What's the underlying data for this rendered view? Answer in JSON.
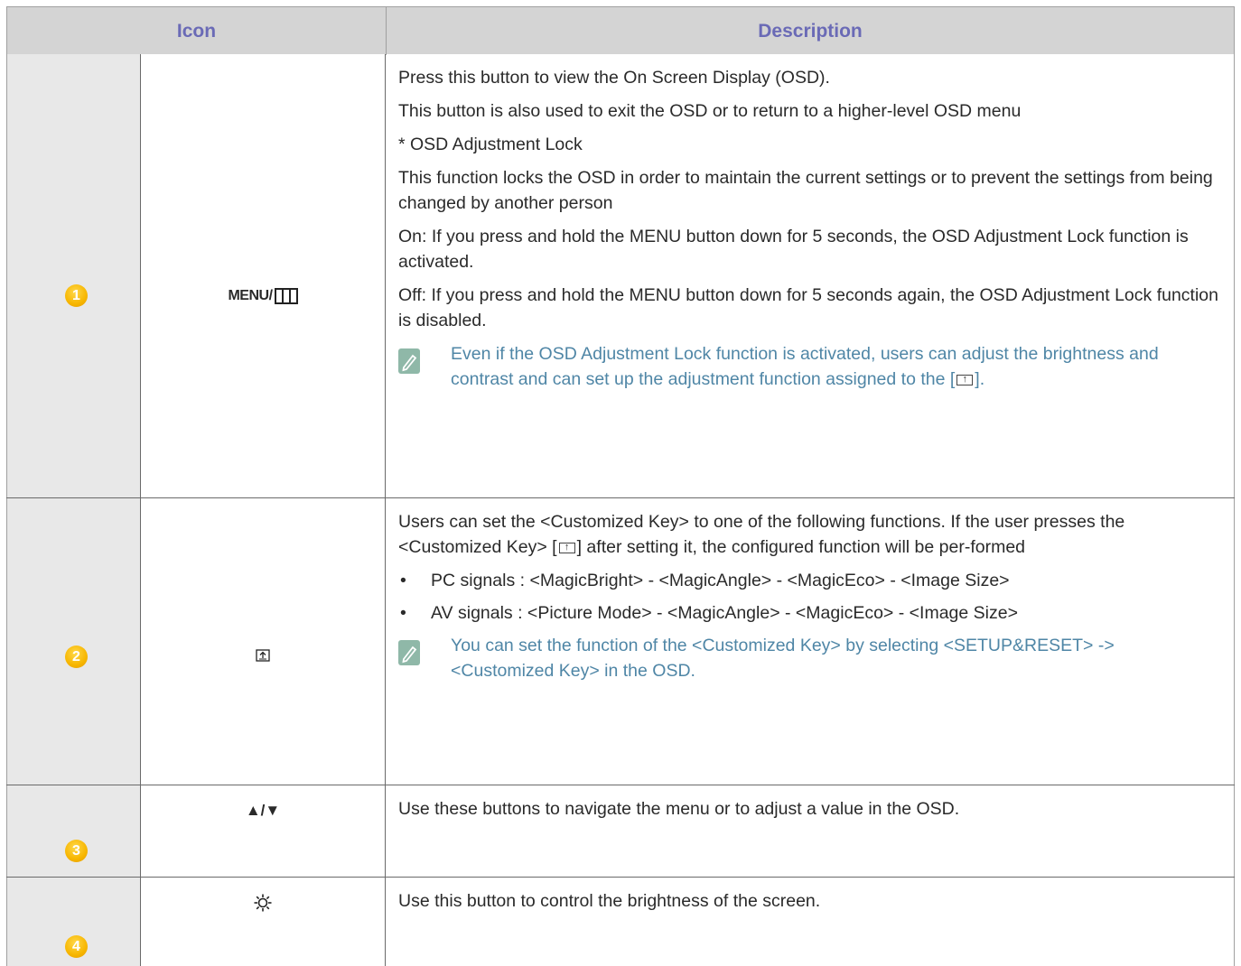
{
  "header": {
    "icon": "Icon",
    "description": "Description"
  },
  "rows": [
    {
      "number": "1",
      "symbol": "MENU/",
      "paragraphs": [
        "Press this button to view the On Screen Display (OSD).",
        "This button is also used to exit the OSD or to return to a higher-level OSD menu",
        "* OSD Adjustment Lock",
        "This function locks the OSD in order to maintain the current settings or to prevent the settings from being changed by another person",
        "On: If you press and hold the MENU button down for 5 seconds, the OSD Adjustment Lock function is activated.",
        "Off: If you press and hold the MENU button down for 5 seconds again, the OSD Adjustment Lock function is disabled."
      ],
      "note_before": "Even if the OSD Adjustment Lock function is activated, users can adjust the brightness and contrast and can set up the adjustment function assigned to the [",
      "note_after": "]."
    },
    {
      "number": "2",
      "intro_before": "Users can set the <Customized Key> to one of the following functions. If the user presses the <Customized Key> [",
      "intro_after": "] after setting it, the configured function will be per-formed",
      "bullets": [
        "PC signals : <MagicBright> - <MagicAngle> - <MagicEco> - <Image Size>",
        "AV signals : <Picture Mode> - <MagicAngle> - <MagicEco> - <Image Size>"
      ],
      "note": "You can set the function of the <Customized Key> by selecting <SETUP&RESET> -> <Customized Key> in the OSD."
    },
    {
      "number": "3",
      "symbol": "▲/▼",
      "text": "Use these buttons to navigate the menu or to adjust a value in the OSD."
    },
    {
      "number": "4",
      "text": "Use this button to control the brightness of the screen."
    }
  ],
  "icons": [
    "menu-grid-icon",
    "customized-key-icon",
    "sun-icon",
    "note-pencil-icon"
  ],
  "colors": {
    "header_bg": "#d4d4d4",
    "header_text": "#6a6ab6",
    "note_text": "#4f86a6",
    "badge": "#f7b600",
    "number_col_bg": "#e8e8e8"
  }
}
